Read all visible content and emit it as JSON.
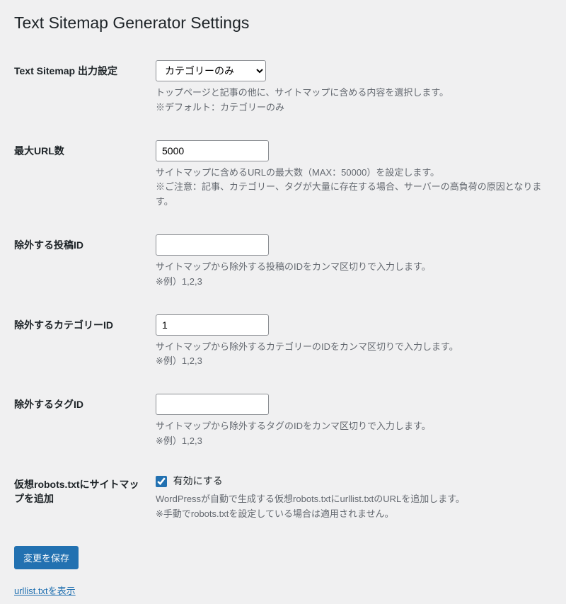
{
  "page_title": "Text Sitemap Generator Settings",
  "fields": {
    "output": {
      "label": "Text Sitemap 出力設定",
      "value": "カテゴリーのみ",
      "desc1": "トップページと記事の他に、サイトマップに含める内容を選択します。",
      "desc2": "※デフォルト：カテゴリーのみ"
    },
    "max_url": {
      "label": "最大URL数",
      "value": "5000",
      "desc1": "サイトマップに含めるURLの最大数（MAX：50000）を設定します。",
      "desc2": "※ご注意：記事、カテゴリー、タグが大量に存在する場合、サーバーの高負荷の原因となります。"
    },
    "exclude_post": {
      "label": "除外する投稿ID",
      "value": "",
      "desc1": "サイトマップから除外する投稿のIDをカンマ区切りで入力します。",
      "desc2": "※例）1,2,3"
    },
    "exclude_cat": {
      "label": "除外するカテゴリーID",
      "value": "1",
      "desc1": "サイトマップから除外するカテゴリーのIDをカンマ区切りで入力します。",
      "desc2": "※例）1,2,3"
    },
    "exclude_tag": {
      "label": "除外するタグID",
      "value": "",
      "desc1": "サイトマップから除外するタグのIDをカンマ区切りで入力します。",
      "desc2": "※例）1,2,3"
    },
    "robots": {
      "label": "仮想robots.txtにサイトマップを追加",
      "checkbox_label": "有効にする",
      "desc1": "WordPressが自動で生成する仮想robots.txtにurllist.txtのURLを追加します。",
      "desc2": "※手動でrobots.txtを設定している場合は適用されません。"
    }
  },
  "submit_label": "変更を保存",
  "link_text": "urllist.txtを表示"
}
